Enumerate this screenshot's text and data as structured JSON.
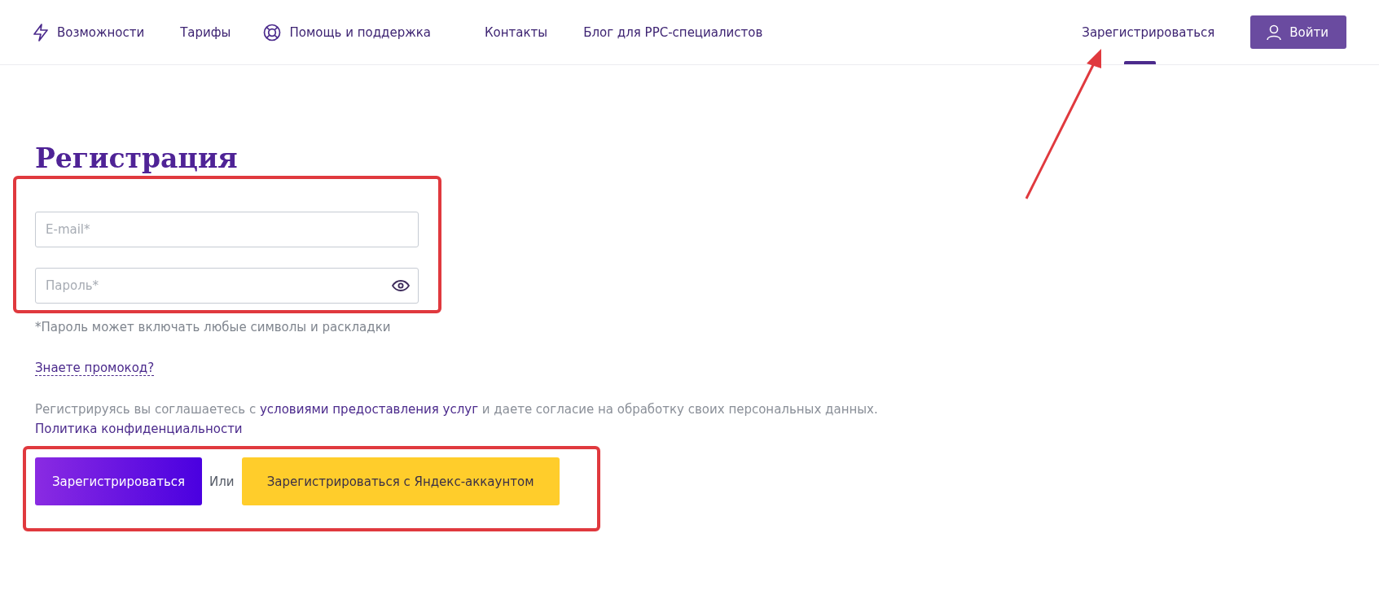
{
  "nav": {
    "items": [
      {
        "label": "Возможности"
      },
      {
        "label": "Тарифы"
      },
      {
        "label": "Помощь и поддержка"
      },
      {
        "label": "Контакты"
      },
      {
        "label": "Блог для PPC-специалистов"
      }
    ],
    "register_link": "Зарегистрироваться",
    "login_button": "Войти"
  },
  "form": {
    "title": "Регистрация",
    "email": {
      "placeholder": "E-mail*"
    },
    "password": {
      "placeholder": "Пароль*"
    },
    "password_hint": "*Пароль может включать любые символы и раскладки",
    "promo_link": "Знаете промокод?",
    "consent": {
      "before": "Регистрируясь вы соглашаетесь с",
      "link": "условиями предоставления услуг",
      "after": "и даете согласие на обработку своих персональных данных."
    },
    "privacy_link": "Политика конфиденциальности",
    "submit_button": "Зарегистрироваться",
    "or_label": "Или",
    "yandex_button": "Зарегистрироваться с Яндекс-аккаунтом"
  }
}
